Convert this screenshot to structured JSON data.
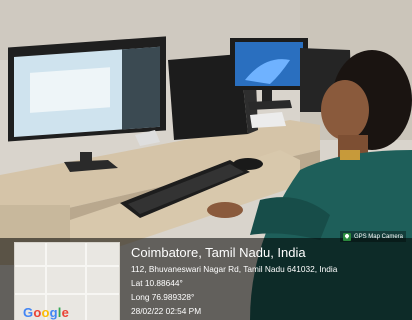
{
  "photo": {
    "scene": "photo",
    "colors": {
      "wall": "#d9d4cc",
      "desk": "#d8c8ac",
      "monitor_screen_left": "#cfe3ee",
      "monitor_screen_right": "#2a6fbf"
    }
  },
  "map_thumbnail": {
    "logo_letters": [
      "G",
      "o",
      "o",
      "g",
      "l",
      "e"
    ]
  },
  "location": {
    "city": "Coimbatore, Tamil Nadu, India",
    "address": "112, Bhuvaneswari Nagar Rd, Tamil Nadu 641032, India",
    "lat": "Lat 10.88644°",
    "long": "Long 76.989328°",
    "datetime": "28/02/22 02:54 PM"
  },
  "badge": {
    "label": "GPS Map Camera",
    "icon": "map-pin-icon"
  }
}
